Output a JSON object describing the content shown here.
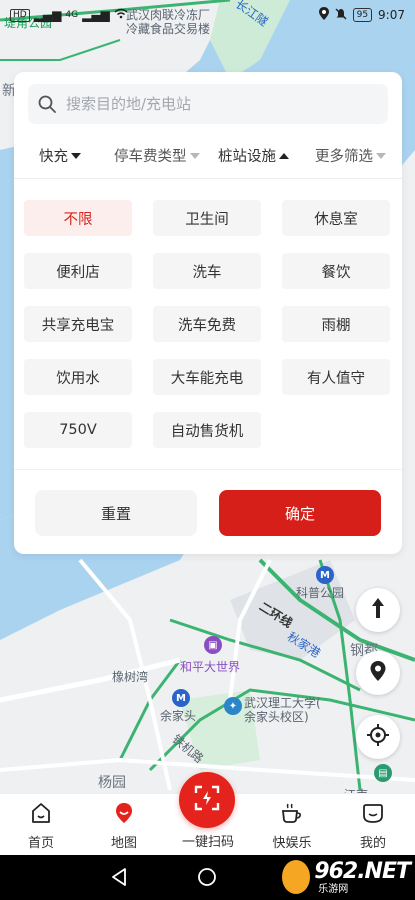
{
  "status_bar": {
    "network": "4G",
    "battery": "95",
    "time": "9:07",
    "carrier_chip": "HD"
  },
  "map": {
    "labels": {
      "top_park": "堤角公园",
      "cold_storage_1": "武汉肉联冷冻厂",
      "cold_storage_2": "冷藏食品交易楼",
      "river_tunnel": "长江隧",
      "left_edge": "新",
      "science_park": "科普公园",
      "ring_road": "二环线",
      "harbor": "钢都",
      "xiangshu_bay": "橡树湾",
      "peace_world": "和平大世界",
      "yujiatou": "余家头",
      "wut_1": "武汉理工大学(",
      "wut_2": "余家头校区)",
      "railway": "铁机路",
      "yangyuan": "杨园",
      "jiangnan": "江南",
      "road_blue": "秋家港"
    }
  },
  "search": {
    "placeholder": "搜索目的地/充电站"
  },
  "filters": {
    "tabs": [
      {
        "label": "快充"
      },
      {
        "label": "停车费类型"
      },
      {
        "label": "桩站设施"
      },
      {
        "label": "更多筛选"
      }
    ],
    "options": [
      {
        "label": "不限"
      },
      {
        "label": "卫生间"
      },
      {
        "label": "休息室"
      },
      {
        "label": "便利店"
      },
      {
        "label": "洗车"
      },
      {
        "label": "餐饮"
      },
      {
        "label": "共享充电宝"
      },
      {
        "label": "洗车免费"
      },
      {
        "label": "雨棚"
      },
      {
        "label": "饮用水"
      },
      {
        "label": "大车能充电"
      },
      {
        "label": "有人值守"
      },
      {
        "label": "750V"
      },
      {
        "label": "自动售货机"
      }
    ],
    "reset_label": "重置",
    "confirm_label": "确定"
  },
  "bottom_nav": {
    "items": [
      {
        "label": "首页"
      },
      {
        "label": "地图"
      },
      {
        "label": "一键扫码"
      },
      {
        "label": "快娱乐"
      },
      {
        "label": "我的"
      }
    ]
  },
  "watermark": {
    "number": "962.NET",
    "sub": "乐游网"
  },
  "colors": {
    "accent_red": "#d71f1a",
    "active_bg": "#fdeeee",
    "river": "#aad3f0",
    "road_green": "#3cb371",
    "park_green": "#cdebd6"
  }
}
